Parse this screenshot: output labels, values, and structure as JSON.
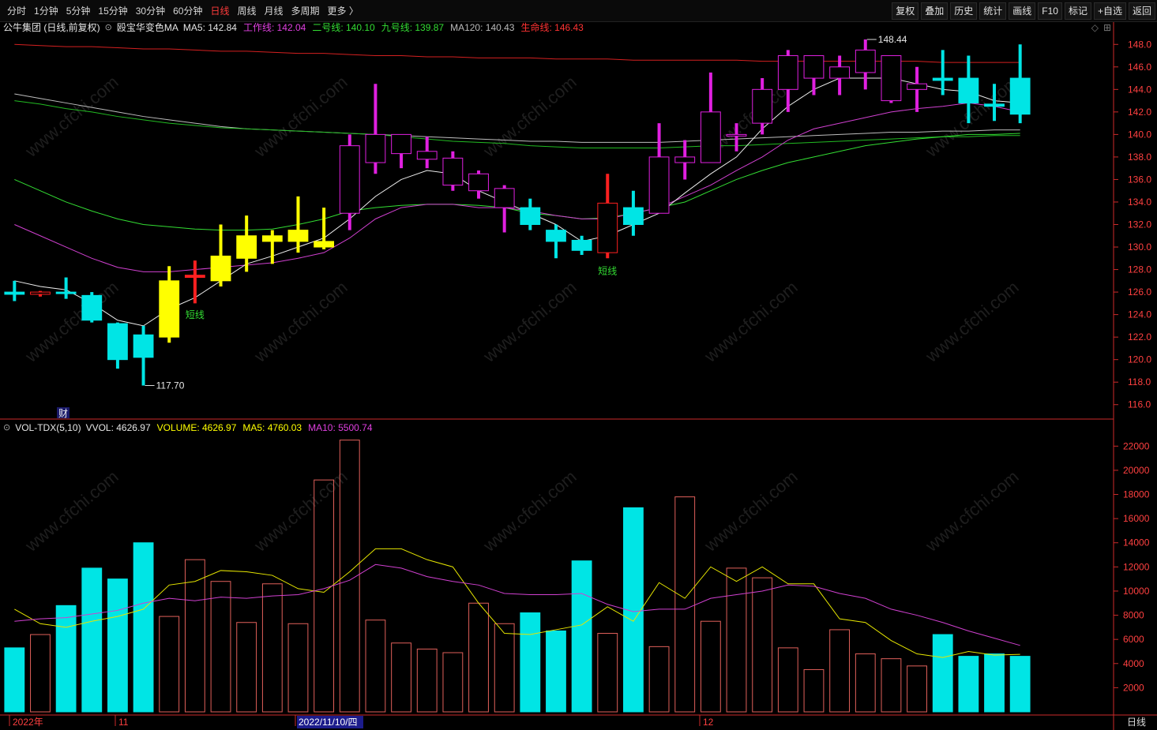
{
  "toolbar": {
    "periods": [
      "分时",
      "1分钟",
      "5分钟",
      "15分钟",
      "30分钟",
      "60分钟",
      "日线",
      "周线",
      "月线",
      "多周期",
      "更多 〉"
    ],
    "active_period": "日线",
    "tools": [
      "复权",
      "叠加",
      "历史",
      "统计",
      "画线",
      "F10",
      "标记",
      "+自选",
      "返回"
    ]
  },
  "price_legend": {
    "stock": "公牛集团 (日线,前复权)",
    "indicator": "殴宝华变色MA",
    "items": [
      {
        "label": "MA5: 142.84",
        "color": "#e6e6e6"
      },
      {
        "label": "工作线: 142.04",
        "color": "#e040e0"
      },
      {
        "label": "二号线: 140.10",
        "color": "#33dd33"
      },
      {
        "label": "九号线: 139.87",
        "color": "#33dd33"
      },
      {
        "label": "MA120: 140.43",
        "color": "#bbbbbb"
      },
      {
        "label": "生命线: 146.43",
        "color": "#ff3333"
      }
    ]
  },
  "volume_legend": {
    "indicator": "VOL-TDX(5,10)",
    "items": [
      {
        "label": "VVOL: 4626.97",
        "color": "#e6e6e6"
      },
      {
        "label": "VOLUME: 4626.97",
        "color": "#ffff00"
      },
      {
        "label": "MA5: 4760.03",
        "color": "#ffff00"
      },
      {
        "label": "MA10: 5500.74",
        "color": "#e040e0"
      }
    ]
  },
  "price_axis": [
    "148.0",
    "146.0",
    "144.0",
    "142.0",
    "140.0",
    "138.0",
    "136.0",
    "134.0",
    "132.0",
    "130.0",
    "128.0",
    "126.0",
    "124.0",
    "122.0",
    "120.0",
    "118.0",
    "116.0"
  ],
  "volume_axis": [
    "22000",
    "20000",
    "18000",
    "16000",
    "14000",
    "12000",
    "10000",
    "8000",
    "6000",
    "4000",
    "2000"
  ],
  "date_axis": [
    "2022年",
    "11",
    "2022/11/10/四",
    "12"
  ],
  "period_label": "日线",
  "annotations": {
    "high": "148.44",
    "low": "117.70",
    "signal1": "短线",
    "signal2": "短线",
    "finance": "财"
  },
  "watermark": "www.cfchi.com",
  "colors": {
    "up": "#e020e0",
    "down": "#00e5e5",
    "yellow": "#ffff00",
    "red": "#ff2020",
    "axis": "#cc2a2a"
  },
  "chart_data": {
    "type": "candlestick",
    "ylim_price": [
      115,
      149
    ],
    "ylim_volume": [
      0,
      23000
    ],
    "candles": [
      {
        "o": 126.0,
        "h": 127.0,
        "l": 125.2,
        "c": 125.8,
        "color": "cyan",
        "vol": 5300
      },
      {
        "o": 125.8,
        "h": 126.1,
        "l": 125.6,
        "c": 126.0,
        "color": "red_hollow",
        "vol": 6400
      },
      {
        "o": 126.0,
        "h": 127.3,
        "l": 125.4,
        "c": 126.0,
        "color": "cyan",
        "vol": 8800
      },
      {
        "o": 125.7,
        "h": 126.0,
        "l": 123.3,
        "c": 123.5,
        "color": "cyan",
        "vol": 11900
      },
      {
        "o": 123.2,
        "h": 123.3,
        "l": 119.2,
        "c": 120.0,
        "color": "cyan",
        "vol": 11000
      },
      {
        "o": 122.2,
        "h": 123.0,
        "l": 117.7,
        "c": 120.2,
        "color": "cyan",
        "vol": 14000
      },
      {
        "o": 122.0,
        "h": 128.3,
        "l": 121.5,
        "c": 127.0,
        "color": "yellow",
        "vol": 7900
      },
      {
        "o": 127.3,
        "h": 128.8,
        "l": 125.0,
        "c": 127.5,
        "color": "red",
        "vol": 12600
      },
      {
        "o": 127.0,
        "h": 132.0,
        "l": 126.5,
        "c": 129.2,
        "color": "yellow",
        "vol": 10800
      },
      {
        "o": 129.0,
        "h": 132.8,
        "l": 127.8,
        "c": 131.0,
        "color": "yellow",
        "vol": 7400
      },
      {
        "o": 131.0,
        "h": 131.5,
        "l": 128.5,
        "c": 130.5,
        "color": "yellow",
        "vol": 10600
      },
      {
        "o": 130.5,
        "h": 134.5,
        "l": 129.5,
        "c": 131.5,
        "color": "yellow",
        "vol": 7300
      },
      {
        "o": 130.0,
        "h": 133.5,
        "l": 129.8,
        "c": 130.5,
        "color": "yellow",
        "vol": 19200
      },
      {
        "o": 133.0,
        "h": 140.0,
        "l": 131.5,
        "c": 139.0,
        "color": "magenta",
        "vol": 22500
      },
      {
        "o": 137.5,
        "h": 144.5,
        "l": 136.5,
        "c": 140.0,
        "color": "magenta",
        "vol": 7600
      },
      {
        "o": 140.0,
        "h": 140.0,
        "l": 137.0,
        "c": 138.3,
        "color": "magenta",
        "vol": 5700
      },
      {
        "o": 138.5,
        "h": 139.8,
        "l": 137.0,
        "c": 137.8,
        "color": "magenta",
        "vol": 5200
      },
      {
        "o": 137.9,
        "h": 138.5,
        "l": 135.0,
        "c": 135.5,
        "color": "magenta",
        "vol": 4900
      },
      {
        "o": 136.5,
        "h": 136.8,
        "l": 134.3,
        "c": 135.0,
        "color": "magenta",
        "vol": 9000
      },
      {
        "o": 135.2,
        "h": 135.5,
        "l": 131.3,
        "c": 133.5,
        "color": "magenta",
        "vol": 7300
      },
      {
        "o": 133.5,
        "h": 134.3,
        "l": 131.5,
        "c": 132.0,
        "color": "cyan",
        "vol": 8200
      },
      {
        "o": 131.5,
        "h": 132.0,
        "l": 129.0,
        "c": 130.5,
        "color": "cyan",
        "vol": 6700
      },
      {
        "o": 130.6,
        "h": 131.0,
        "l": 129.3,
        "c": 129.7,
        "color": "cyan",
        "vol": 12500
      },
      {
        "o": 129.5,
        "h": 136.5,
        "l": 129.0,
        "c": 133.9,
        "color": "red_hollow",
        "vol": 6500
      },
      {
        "o": 133.5,
        "h": 135.0,
        "l": 131.0,
        "c": 132.0,
        "color": "cyan",
        "vol": 16900
      },
      {
        "o": 133.0,
        "h": 141.0,
        "l": 133.0,
        "c": 138.0,
        "color": "magenta",
        "vol": 5400
      },
      {
        "o": 138.0,
        "h": 139.5,
        "l": 136.0,
        "c": 137.5,
        "color": "magenta",
        "vol": 17800
      },
      {
        "o": 137.5,
        "h": 145.5,
        "l": 137.5,
        "c": 142.0,
        "color": "magenta",
        "vol": 7500
      },
      {
        "o": 140.0,
        "h": 141.0,
        "l": 138.5,
        "c": 140.0,
        "color": "magenta",
        "vol": 11900
      },
      {
        "o": 141.0,
        "h": 145.0,
        "l": 140.0,
        "c": 144.0,
        "color": "magenta",
        "vol": 11100
      },
      {
        "o": 144.0,
        "h": 147.5,
        "l": 142.0,
        "c": 147.0,
        "color": "magenta",
        "vol": 5300
      },
      {
        "o": 145.0,
        "h": 147.0,
        "l": 143.5,
        "c": 147.0,
        "color": "magenta",
        "vol": 3500
      },
      {
        "o": 146.0,
        "h": 147.0,
        "l": 143.5,
        "c": 145.0,
        "color": "magenta",
        "vol": 6800
      },
      {
        "o": 145.5,
        "h": 148.44,
        "l": 144.0,
        "c": 147.5,
        "color": "magenta",
        "vol": 4800
      },
      {
        "o": 147.0,
        "h": 147.0,
        "l": 142.8,
        "c": 143.0,
        "color": "magenta",
        "vol": 4400
      },
      {
        "o": 144.0,
        "h": 146.0,
        "l": 142.0,
        "c": 144.5,
        "color": "magenta",
        "vol": 3800
      },
      {
        "o": 144.8,
        "h": 147.5,
        "l": 143.5,
        "c": 145.0,
        "color": "cyan",
        "vol": 6400
      },
      {
        "o": 145.0,
        "h": 147.0,
        "l": 141.0,
        "c": 142.8,
        "color": "cyan",
        "vol": 4600
      },
      {
        "o": 142.5,
        "h": 144.5,
        "l": 141.2,
        "c": 142.7,
        "color": "cyan",
        "vol": 4800
      },
      {
        "o": 145.0,
        "h": 148.0,
        "l": 141.0,
        "c": 141.8,
        "color": "cyan",
        "vol": 4600
      }
    ],
    "lines": {
      "white": [
        127.0,
        126.5,
        126.2,
        125.0,
        123.5,
        123.0,
        124.5,
        125.5,
        127.0,
        128.5,
        129.2,
        130.0,
        130.8,
        132.5,
        134.5,
        136.0,
        136.8,
        136.5,
        135.0,
        134.0,
        133.0,
        132.0,
        130.5,
        131.0,
        132.0,
        133.0,
        134.8,
        136.5,
        138.0,
        140.5,
        142.5,
        144.0,
        145.0,
        145.0,
        145.0,
        144.5,
        144.0,
        143.8,
        143.0,
        142.8
      ],
      "magenta": [
        132.0,
        131.0,
        130.0,
        129.0,
        128.2,
        127.8,
        127.8,
        128.0,
        128.2,
        128.4,
        128.6,
        129.0,
        129.5,
        130.8,
        132.5,
        133.5,
        133.8,
        133.8,
        133.5,
        133.5,
        133.2,
        132.8,
        132.5,
        132.5,
        133.0,
        133.5,
        134.5,
        135.5,
        136.8,
        138.0,
        139.5,
        140.5,
        141.0,
        141.5,
        142.0,
        142.3,
        142.5,
        142.8,
        142.5,
        142.0
      ],
      "green": [
        136.0,
        135.0,
        134.0,
        133.2,
        132.5,
        132.0,
        131.8,
        131.6,
        131.5,
        131.5,
        131.6,
        132.0,
        132.5,
        133.2,
        133.5,
        133.7,
        133.8,
        133.8,
        133.7,
        133.5,
        133.0,
        132.8,
        132.5,
        132.6,
        133.0,
        133.5,
        134.0,
        135.0,
        136.0,
        136.8,
        137.5,
        138.0,
        138.5,
        139.0,
        139.3,
        139.6,
        139.8,
        140.0,
        140.0,
        140.1
      ],
      "green2": [
        143.0,
        142.7,
        142.3,
        142.0,
        141.6,
        141.3,
        141.0,
        140.8,
        140.6,
        140.5,
        140.4,
        140.3,
        140.2,
        140.1,
        140.0,
        139.8,
        139.6,
        139.4,
        139.3,
        139.2,
        139.0,
        138.9,
        138.8,
        138.8,
        138.8,
        138.8,
        138.9,
        139.0,
        139.0,
        139.1,
        139.2,
        139.3,
        139.4,
        139.5,
        139.6,
        139.7,
        139.8,
        139.8,
        139.9,
        139.9
      ],
      "gray": [
        143.6,
        143.2,
        142.8,
        142.4,
        142.0,
        141.6,
        141.3,
        141.0,
        140.7,
        140.5,
        140.4,
        140.3,
        140.2,
        140.1,
        140.0,
        139.9,
        139.8,
        139.7,
        139.6,
        139.5,
        139.4,
        139.4,
        139.3,
        139.3,
        139.3,
        139.3,
        139.4,
        139.5,
        139.6,
        139.7,
        139.8,
        139.9,
        140.0,
        140.1,
        140.2,
        140.2,
        140.3,
        140.3,
        140.4,
        140.4
      ],
      "red": [
        148.0,
        147.9,
        147.8,
        147.8,
        147.7,
        147.6,
        147.6,
        147.5,
        147.4,
        147.4,
        147.3,
        147.2,
        147.2,
        147.1,
        147.0,
        147.0,
        146.9,
        146.9,
        146.8,
        146.8,
        146.8,
        146.7,
        146.7,
        146.7,
        146.6,
        146.6,
        146.6,
        146.6,
        146.6,
        146.5,
        146.5,
        146.5,
        146.5,
        146.5,
        146.5,
        146.5,
        146.4,
        146.4,
        146.4,
        146.4
      ],
      "vol_ma5": [
        8500,
        7300,
        7000,
        7500,
        7900,
        8500,
        10500,
        10800,
        11700,
        11600,
        11300,
        10200,
        9900,
        11600,
        13500,
        13500,
        12600,
        12000,
        9000,
        6500,
        6400,
        6800,
        7200,
        8700,
        7500,
        10700,
        9400,
        12000,
        10800,
        12000,
        10600,
        10600,
        7700,
        7400,
        5900,
        4800,
        4500,
        5000,
        4700,
        4760
      ],
      "vol_ma10": [
        7500,
        7700,
        7800,
        8100,
        8400,
        9000,
        9400,
        9200,
        9500,
        9400,
        9600,
        9700,
        10200,
        10900,
        12200,
        11900,
        11200,
        10800,
        10500,
        9800,
        9700,
        9700,
        9800,
        8900,
        8300,
        8500,
        8500,
        9400,
        9700,
        10000,
        10500,
        10400,
        9800,
        9400,
        8500,
        8000,
        7400,
        6700,
        6100,
        5500
      ]
    }
  }
}
